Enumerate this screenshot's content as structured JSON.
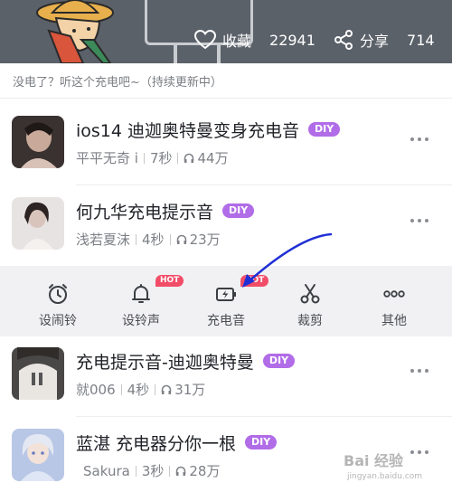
{
  "header": {
    "favorite_label": "收藏",
    "favorite_count": "22941",
    "share_label": "分享",
    "share_count": "714"
  },
  "playlist": {
    "description": "没电了？听这个充电吧~（持续更新中）"
  },
  "songs": [
    {
      "title": "ios14 迪迦奥特曼变身充电音",
      "badge": "DIY",
      "author": "平平无奇 i",
      "duration": "7秒",
      "plays": "44万"
    },
    {
      "title": "何九华充电提示音",
      "badge": "DIY",
      "author": "浅若夏沫",
      "duration": "4秒",
      "plays": "23万"
    },
    {
      "title": "充电提示音-迪迦奥特曼",
      "badge": "DIY",
      "author": "就006",
      "duration": "4秒",
      "plays": "31万"
    },
    {
      "title": "蓝湛 充电器分你一根",
      "badge": "DIY",
      "author": "Sakura",
      "duration": "3秒",
      "plays": "28万"
    }
  ],
  "actions": [
    {
      "label": "设闹铃",
      "icon": "alarm-clock-icon",
      "badge": ""
    },
    {
      "label": "设铃声",
      "icon": "bell-icon",
      "badge": "HOT"
    },
    {
      "label": "充电音",
      "icon": "charging-battery-icon",
      "badge": "HOT"
    },
    {
      "label": "裁剪",
      "icon": "scissors-icon",
      "badge": ""
    },
    {
      "label": "其他",
      "icon": "more-dots-icon",
      "badge": ""
    }
  ],
  "watermark": {
    "text": "Bai 经验",
    "sub": "jingyan.baidu.com"
  },
  "colors": {
    "diy": "#b16ce8",
    "hot": "#f24d68",
    "arrow": "#1f2fd6",
    "header": "#5b6169"
  }
}
